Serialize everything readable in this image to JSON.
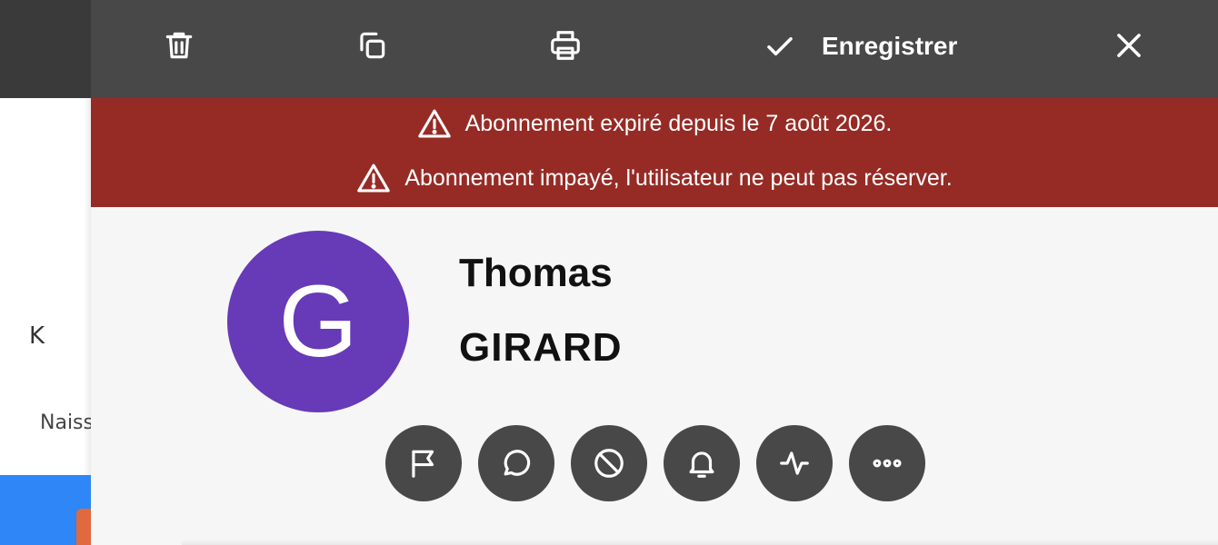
{
  "background": {
    "letter": "K",
    "label": "Naissance"
  },
  "toolbar": {
    "save_label": "Enregistrer",
    "icons": [
      "trash-icon",
      "copy-icon",
      "printer-icon",
      "check-icon",
      "close-icon"
    ]
  },
  "alerts": [
    {
      "icon": "warning-icon",
      "text": "Abonnement expiré depuis le 7 août 2026."
    },
    {
      "icon": "warning-icon",
      "text": "Abonnement impayé, l'utilisateur ne peut pas réserver."
    }
  ],
  "profile": {
    "initial": "G",
    "first_name": "Thomas",
    "last_name": "GIRARD",
    "avatar_color": "#673ab7"
  },
  "actions": [
    "flag-icon",
    "chat-icon",
    "block-icon",
    "bell-icon",
    "activity-icon",
    "more-icon"
  ],
  "colors": {
    "toolbar": "#484848",
    "alert": "#962b25",
    "panel": "#f6f6f6",
    "accent_blue": "#2f86f6"
  }
}
